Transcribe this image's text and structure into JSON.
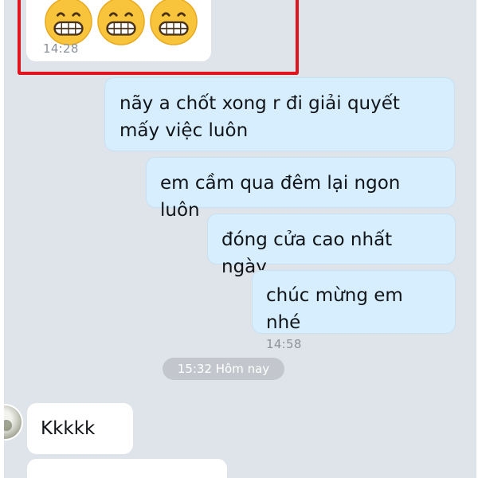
{
  "colors": {
    "chat_background": "#dfe3ea",
    "incoming_bubble": "#ffffff",
    "outgoing_bubble": "#d6eefd",
    "highlight_border": "#e0141c",
    "timestamp": "#8b929a",
    "day_divider": "#c3c7cd"
  },
  "messages": [
    {
      "sender": "other",
      "type": "emoji",
      "emojis": [
        "grinning-face-with-smiling-eyes",
        "grinning-face-with-smiling-eyes",
        "grinning-face-with-smiling-eyes"
      ],
      "time": "14:28",
      "highlighted": true
    },
    {
      "sender": "me",
      "text": "nãy a chốt xong r đi giải quyết mấy việc luôn"
    },
    {
      "sender": "me",
      "text": "em cầm qua đêm lại ngon luôn"
    },
    {
      "sender": "me",
      "text": "đóng cửa cao nhất ngày"
    },
    {
      "sender": "me",
      "text": "chúc mừng em nhé",
      "time": "14:58"
    }
  ],
  "day_divider": "15:32 Hôm nay",
  "after_divider": [
    {
      "sender": "other",
      "text": "Kkkkk"
    }
  ]
}
